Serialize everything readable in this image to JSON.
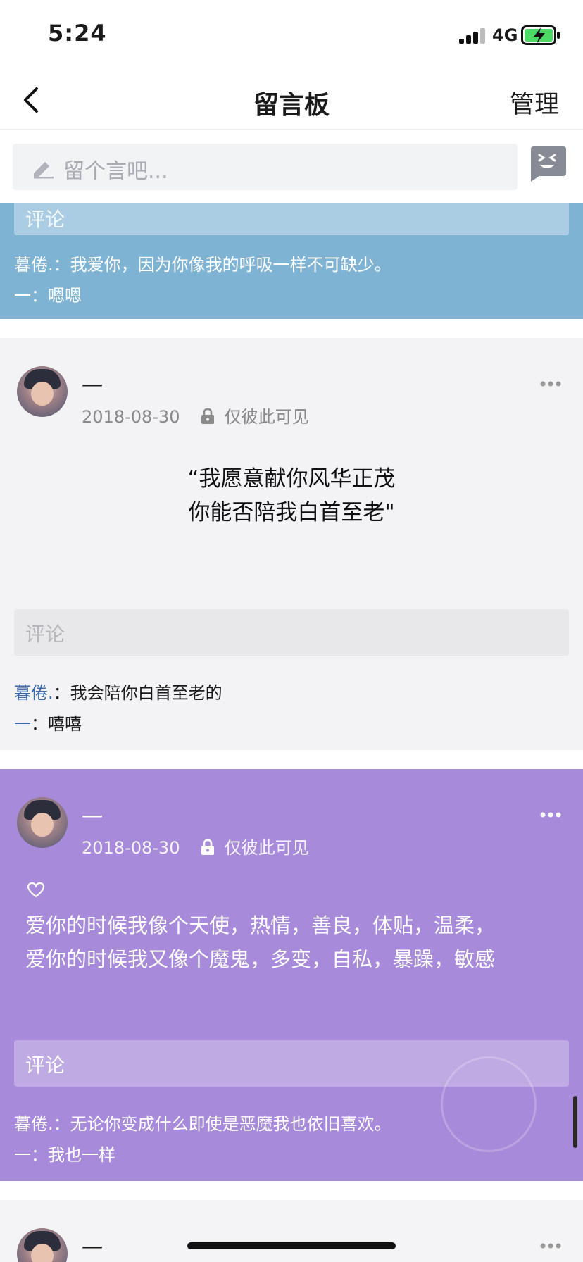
{
  "status_bar": {
    "time": "5:24",
    "network": "4G"
  },
  "nav": {
    "title": "留言板",
    "manage": "管理"
  },
  "composer": {
    "placeholder": "留个言吧..."
  },
  "cards": [
    {
      "comment_placeholder": "评论",
      "replies": [
        {
          "name": "暮倦.",
          "text": "：我爱你，因为你像我的呼吸一样不可缺少。"
        },
        {
          "name": "一",
          "text": "：嗯嗯"
        }
      ]
    },
    {
      "author": "一",
      "date": "2018-08-30",
      "visibility": "仅彼此可见",
      "content": [
        "“我愿意献你风华正茂",
        "你能否陪我白首至老\""
      ],
      "comment_placeholder": "评论",
      "replies": [
        {
          "name": "暮倦.",
          "text": "：我会陪你白首至老的"
        },
        {
          "name": "一",
          "text": "：嘻嘻"
        }
      ]
    },
    {
      "author": "一",
      "date": "2018-08-30",
      "visibility": "仅彼此可见",
      "content": [
        "爱你的时候我像个天使，热情，善良，体贴，温柔，",
        "爱你的时候我又像个魔鬼，多变，自私，暴躁，敏感"
      ],
      "comment_placeholder": "评论",
      "replies": [
        {
          "name": "暮倦.",
          "text": "：无论你变成什么即使是恶魔我也依旧喜欢。"
        },
        {
          "name": "一",
          "text": "：我也一样"
        }
      ]
    },
    {
      "author": "一"
    }
  ],
  "colors": {
    "blue_card": "#7fb3d4",
    "purple_card": "#a78ad9",
    "reply_name": "#3d6aa8"
  }
}
